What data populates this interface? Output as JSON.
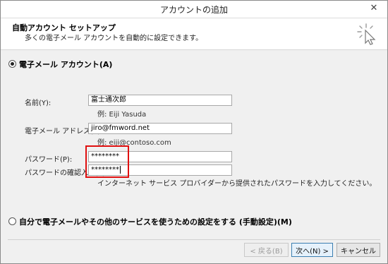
{
  "window": {
    "title": "アカウントの追加",
    "close_glyph": "✕"
  },
  "header": {
    "title": "自動アカウント セットアップ",
    "subtitle": "多くの電子メール アカウントを自動的に設定できます。"
  },
  "email_account_option": {
    "label": "電子メール アカウント(A)",
    "selected": true
  },
  "form": {
    "name_label": "名前(Y):",
    "name_value": "富士通次郎",
    "name_example": "例: Eiji Yasuda",
    "email_label": "電子メール アドレス(E):",
    "email_value": "jiro@fmword.net",
    "email_example": "例: eiji@contoso.com",
    "password_label": "パスワード(P):",
    "password_value": "********",
    "confirm_label": "パスワードの確認入力(T):",
    "confirm_value": "********",
    "password_note": "インターネット サービス プロバイダーから提供されたパスワードを入力してください。"
  },
  "manual_option": {
    "label": "自分で電子メールやその他のサービスを使うための設定をする (手動設定)(M)",
    "selected": false
  },
  "buttons": {
    "back": "< 戻る(B)",
    "next": "次へ(N) >",
    "cancel": "キャンセル"
  },
  "colors": {
    "highlight_box": "#e01010",
    "window_bg": "#f0f0f0"
  }
}
